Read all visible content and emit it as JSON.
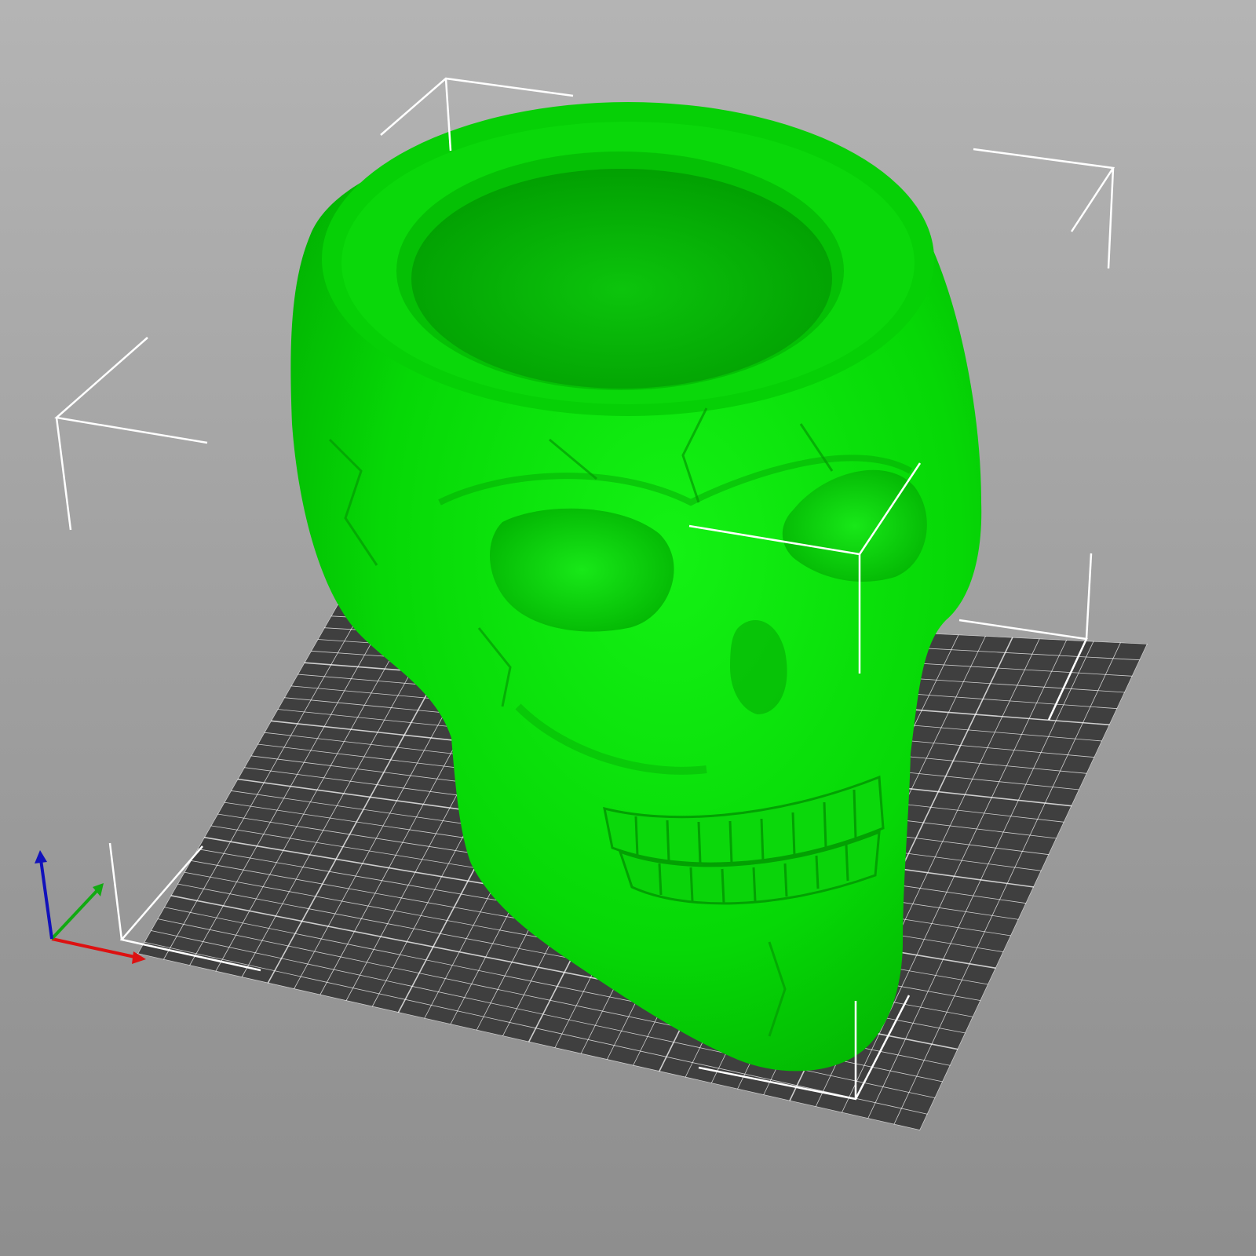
{
  "viewport": {
    "kind": "3d-print-preview",
    "background_top": "#b4b4b4",
    "background_bottom": "#8e8e8e"
  },
  "bed": {
    "plate_color": "#3f3f3f",
    "grid_color": "#ffffff"
  },
  "model": {
    "name": "skull-planter",
    "color": "#00e000",
    "state": "selected"
  },
  "selection_box": {
    "color": "#ffffff"
  },
  "axes": {
    "x_color": "#dd1111",
    "y_color": "#11aa11",
    "z_color": "#1111bb"
  }
}
